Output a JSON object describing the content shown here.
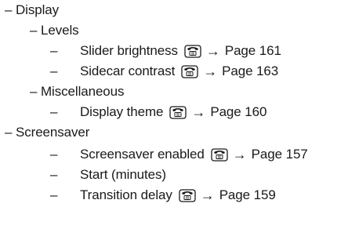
{
  "tree": {
    "display": {
      "label": "Display",
      "levels": {
        "label": "Levels",
        "items": [
          {
            "label": "Slider brightness",
            "page": "Page 161"
          },
          {
            "label": "Sidecar contrast",
            "page": "Page 163"
          }
        ]
      },
      "misc": {
        "label": "Miscellaneous",
        "items": [
          {
            "label": "Display theme",
            "page": "Page 160"
          }
        ]
      }
    },
    "screensaver": {
      "label": "Screensaver",
      "items": [
        {
          "label": "Screensaver enabled",
          "page": "Page 157"
        },
        {
          "label": "Start (minutes)"
        },
        {
          "label": "Transition delay",
          "page": "Page 159"
        }
      ]
    }
  },
  "dash": "–",
  "arrow": "→",
  "icons": {
    "phone": "telephone-icon"
  }
}
